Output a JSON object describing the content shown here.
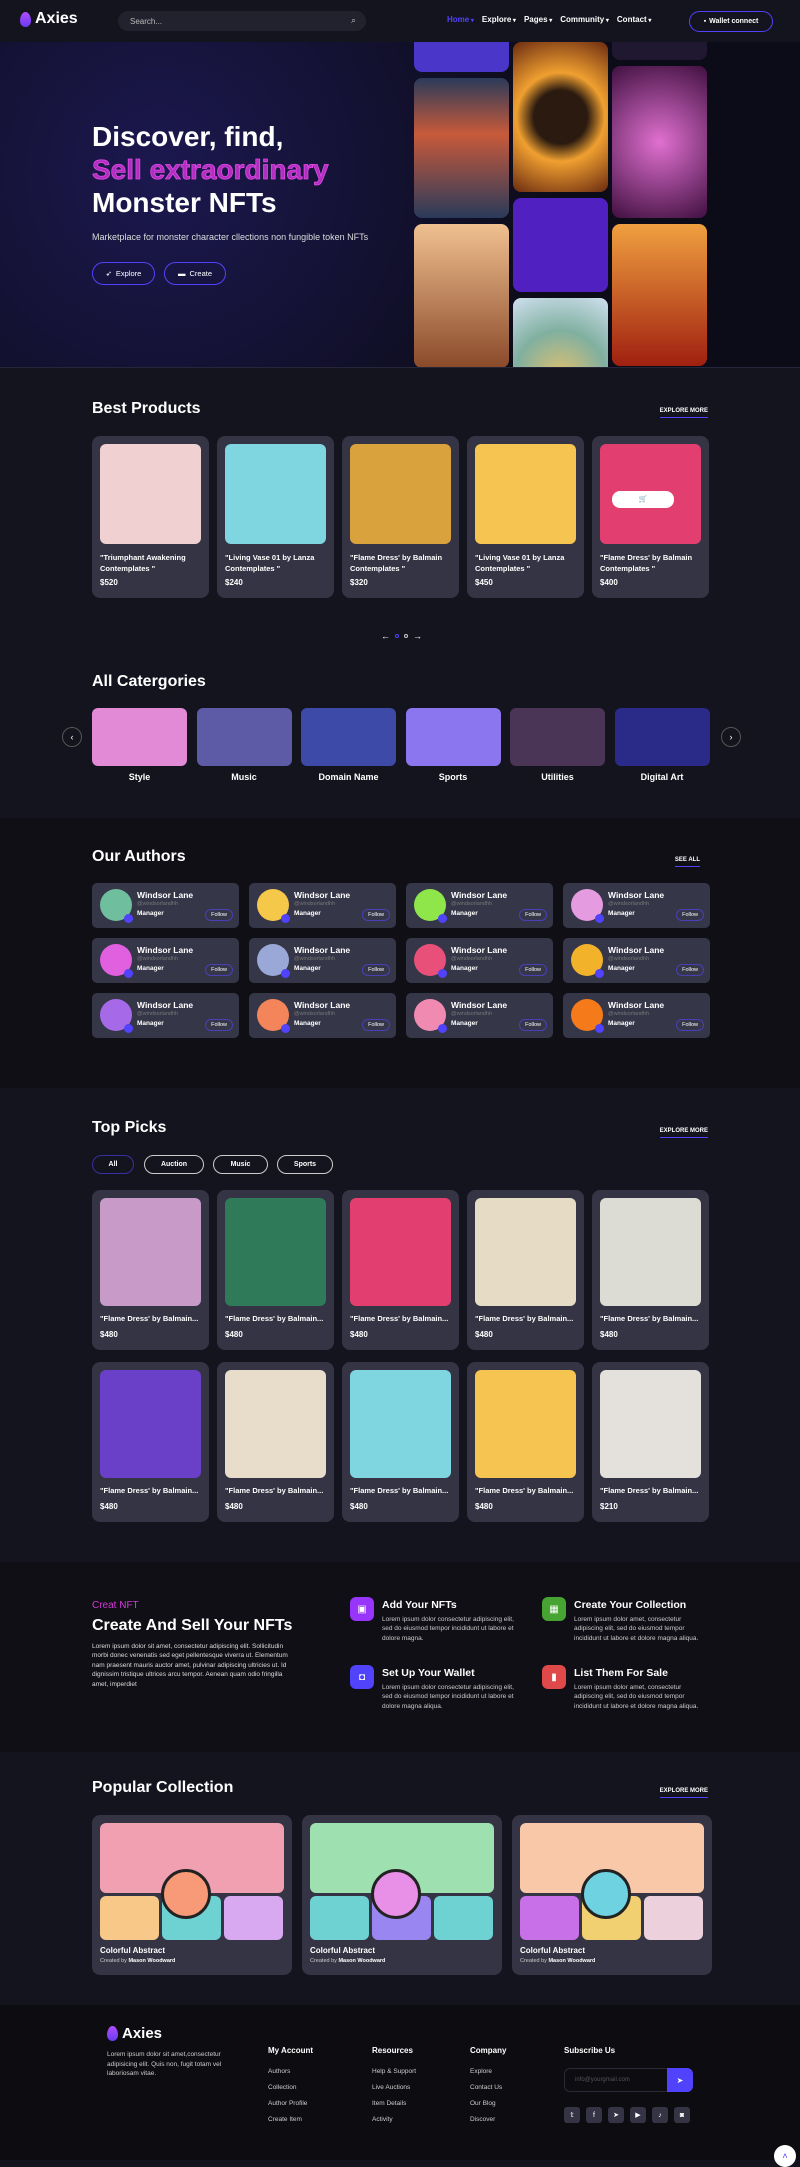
{
  "header": {
    "logo": "Axies",
    "search_placeholder": "Search...",
    "nav": [
      "Home",
      "Explore",
      "Pages",
      "Community",
      "Contact"
    ],
    "wallet": "Wallet connect"
  },
  "hero": {
    "line1": "Discover, find,",
    "line2": "Sell extraordinary",
    "line3": "Monster NFTs",
    "subtitle": "Marketplace for monster character cllections non fungible token NFTs",
    "explore": "Explore",
    "create": "Create"
  },
  "best": {
    "title": "Best Products",
    "more": "EXPLORE MORE",
    "items": [
      {
        "title": "\"Triumphant Awakening Contemplates \"",
        "price": "$520",
        "color": "#f0d0d0"
      },
      {
        "title": "\"Living Vase 01 by Lanza Contemplates \"",
        "price": "$240",
        "color": "#7fd6e0"
      },
      {
        "title": "\"Flame Dress' by Balmain Contemplates \"",
        "price": "$320",
        "color": "#d9a23c"
      },
      {
        "title": "\"Living Vase 01 by Lanza Contemplates \"",
        "price": "$450",
        "color": "#f6c451"
      },
      {
        "title": "\"Flame Dress' by Balmain Contemplates \"",
        "price": "$400",
        "color": "#e23f70"
      }
    ]
  },
  "categories": {
    "title": "All Catergories",
    "items": [
      {
        "label": "Style",
        "color": "#e28ad6"
      },
      {
        "label": "Music",
        "color": "#5d5aa6"
      },
      {
        "label": "Domain Name",
        "color": "#3d4aa8"
      },
      {
        "label": "Sports",
        "color": "#8b76f0"
      },
      {
        "label": "Utilities",
        "color": "#4a3556"
      },
      {
        "label": "Digital Art",
        "color": "#2a2a88"
      }
    ]
  },
  "authors": {
    "title": "Our Authors",
    "more": "SEE ALL",
    "name": "Windsor Lane",
    "handle": "@windsorlandhh",
    "role": "Manager",
    "follow": "Follow",
    "avatar_colors": [
      "#6fbf9f",
      "#f6c84a",
      "#8ee64a",
      "#e59be0",
      "#e060e0",
      "#9aa8d8",
      "#e8507a",
      "#f2b22a",
      "#a66ae8",
      "#f4845a",
      "#f08ab0",
      "#f57a1a"
    ]
  },
  "top": {
    "title": "Top Picks",
    "more": "EXPLORE MORE",
    "filters": [
      "All",
      "Auction",
      "Music",
      "Sports"
    ],
    "active_filter": "All",
    "items": [
      {
        "title": "\"Flame Dress' by Balmain...",
        "price": "$480",
        "color": "#c89ac8"
      },
      {
        "title": "\"Flame Dress' by Balmain...",
        "price": "$480",
        "color": "#2f7a58"
      },
      {
        "title": "\"Flame Dress' by Balmain...",
        "price": "$480",
        "color": "#e23f70"
      },
      {
        "title": "\"Flame Dress' by Balmain...",
        "price": "$480",
        "color": "#e6dcc6"
      },
      {
        "title": "\"Flame Dress' by Balmain...",
        "price": "$480",
        "color": "#dcdcd4"
      },
      {
        "title": "\"Flame Dress' by Balmain...",
        "price": "$480",
        "color": "#6a40c8"
      },
      {
        "title": "\"Flame Dress' by Balmain...",
        "price": "$480",
        "color": "#e8dccb"
      },
      {
        "title": "\"Flame Dress' by Balmain...",
        "price": "$480",
        "color": "#7fd6e0"
      },
      {
        "title": "\"Flame Dress' by Balmain...",
        "price": "$480",
        "color": "#f6c451"
      },
      {
        "title": "\"Flame Dress' by Balmain...",
        "price": "$210",
        "color": "#e4e0dc"
      }
    ]
  },
  "create": {
    "kicker": "Creat NFT",
    "title": "Create And Sell Your NFTs",
    "text": "Lorem ipsum dolor sit amet, consectetur adipiscing elit. Sollicitudin morbi donec venenatis sed eget pellentesque viverra ut. Elementum nam praesent mauris auctor amet, pulvinar adipiscing ultricies ut. Id dignissim tristique ultrices arcu tempor. Aenean quam odio fringilla amet, imperdiet",
    "steps": [
      {
        "title": "Add Your NFTs",
        "text": "Lorem ipsum dolor consectetur adipiscing elit, sed do eiusmod tempor incididunt ut labore et dolore magna.",
        "color": "#9835fb",
        "icon": "image-icon"
      },
      {
        "title": "Create Your Collection",
        "text": "Lorem ipsum dolor amet, consectetur adipiscing elit, sed do eiusmod tempor incididunt ut labore et dolore magna aliqua.",
        "color": "#47a432",
        "icon": "grid-icon"
      },
      {
        "title": "Set Up Your Wallet",
        "text": "Lorem ipsum dolor consectetur adipiscing elit, sed do eiusmod tempor incididunt ut labore et dolore magna aliqua.",
        "color": "#5142fc",
        "icon": "wallet-icon"
      },
      {
        "title": "List Them For Sale",
        "text": "Lorem ipsum dolor amet, consectetur adipiscing elit, sed do eiusmod tempor incididunt ut labore et dolore magna aliqua.",
        "color": "#df4949",
        "icon": "bookmark-icon"
      }
    ]
  },
  "popular": {
    "title": "Popular Collection",
    "more": "EXPLORE MORE",
    "items": [
      {
        "title": "Colorful Abstract",
        "created_by": "Created by",
        "author": "Mason Woodward",
        "colors": [
          "#f0a0b0",
          "#f8c888",
          "#6ed2d2",
          "#d8a8f0",
          "#f89a78"
        ]
      },
      {
        "title": "Colorful Abstract",
        "created_by": "Created by",
        "author": "Mason Woodward",
        "colors": [
          "#9ee0b0",
          "#6ed2d2",
          "#9a86f0",
          "#6ed2d2",
          "#e890e8"
        ]
      },
      {
        "title": "Colorful Abstract",
        "created_by": "Created by",
        "author": "Mason Woodward",
        "colors": [
          "#f8c8a8",
          "#c870e8",
          "#f0d070",
          "#ecd0dc",
          "#6ed2e0"
        ]
      }
    ]
  },
  "footer": {
    "logo": "Axies",
    "about": "Lorem ipsum dolor sit amet,consectetur adipisicing elit. Quis non, fugit totam vel laboriosam vitae.",
    "columns": [
      {
        "title": "My Account",
        "links": [
          "Authors",
          "Collection",
          "Author Profile",
          "Create Item"
        ]
      },
      {
        "title": "Resources",
        "links": [
          "Help & Support",
          "Live Auctions",
          "Item Details",
          "Activity"
        ]
      },
      {
        "title": "Company",
        "links": [
          "Explore",
          "Contact Us",
          "Our Blog",
          "Discover"
        ]
      }
    ],
    "subscribe_title": "Subscribe Us",
    "email_placeholder": "info@yourgmail.com",
    "social": [
      "twitter-icon",
      "facebook-icon",
      "telegram-icon",
      "youtube-icon",
      "tiktok-icon",
      "discord-icon"
    ]
  },
  "colors": {
    "accent": "#5142fc",
    "pink": "#d33ad8",
    "background": "#14141f",
    "card": "#343444"
  }
}
